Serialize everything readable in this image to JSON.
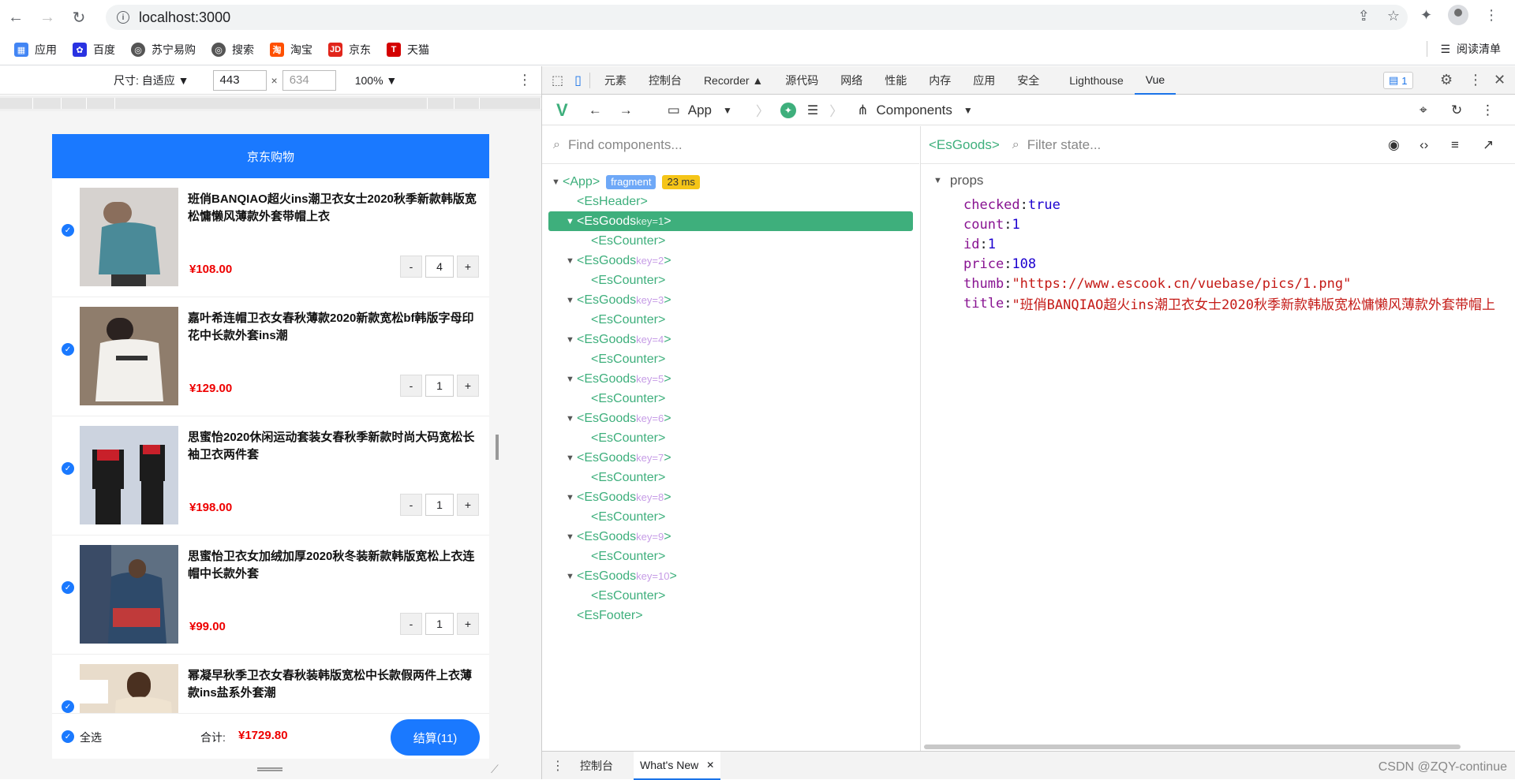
{
  "browser": {
    "url": "localhost:3000",
    "bookmarks": [
      {
        "label": "应用",
        "color": "#4285f4"
      },
      {
        "label": "百度",
        "color": "#2932e1"
      },
      {
        "label": "苏宁易购",
        "color": "#555555"
      },
      {
        "label": "搜索",
        "color": "#555555"
      },
      {
        "label": "淘宝",
        "color": "#ff5000"
      },
      {
        "label": "京东",
        "color": "#e1251b"
      },
      {
        "label": "天猫",
        "color": "#d40000"
      }
    ],
    "reading_list": "阅读清单"
  },
  "device": {
    "size_label": "尺寸: 自适应 ▼",
    "width": "443",
    "height_placeholder": "634",
    "times": "×",
    "zoom": "100% ▼"
  },
  "app": {
    "header": "京东购物",
    "goods": [
      {
        "title": "班俏BANQIAO超火ins潮卫衣女士2020秋季新款韩版宽松慵懒风薄款外套带帽上衣",
        "price": "¥108.00",
        "count": "4"
      },
      {
        "title": "嘉叶希连帽卫衣女春秋薄款2020新款宽松bf韩版字母印花中长款外套ins潮",
        "price": "¥129.00",
        "count": "1"
      },
      {
        "title": "思蜜怡2020休闲运动套装女春秋季新款时尚大码宽松长袖卫衣两件套",
        "price": "¥198.00",
        "count": "1"
      },
      {
        "title": "思蜜怡卫衣女加绒加厚2020秋冬装新款韩版宽松上衣连帽中长款外套",
        "price": "¥99.00",
        "count": "1"
      },
      {
        "title": "幂凝早秋季卫衣女春秋装韩版宽松中长款假两件上衣薄款ins盐系外套潮",
        "price": "",
        "count": ""
      }
    ],
    "minus": "-",
    "plus": "+",
    "footer": {
      "select_all": "全选",
      "total_label": "合计:",
      "total_value": "¥1729.80",
      "checkout": "结算(11)"
    }
  },
  "devtools": {
    "tabs": [
      "元素",
      "控制台",
      "Recorder ▲",
      "源代码",
      "网络",
      "性能",
      "内存",
      "应用",
      "安全",
      "Lighthouse",
      "Vue"
    ],
    "badge": "1",
    "vue_bar": {
      "app": "App",
      "components": "Components"
    },
    "find_placeholder": "Find components...",
    "filter_placeholder": "Filter state...",
    "selected_component": "<EsGoods>",
    "tree": {
      "app": "<App>",
      "fragment": "fragment",
      "time": "23 ms",
      "header": "<EsHeader>",
      "footer": "<EsFooter>",
      "goods_label": "<EsGoods",
      "counter": "<EsCounter>",
      "keys": [
        "key=1",
        "key=2",
        "key=3",
        "key=4",
        "key=5",
        "key=6",
        "key=7",
        "key=8",
        "key=9",
        "key=10"
      ]
    },
    "props_title": "props",
    "props": [
      {
        "key": "checked",
        "value": "true",
        "kind": "num"
      },
      {
        "key": "count",
        "value": "1",
        "kind": "num"
      },
      {
        "key": "id",
        "value": "1",
        "kind": "num"
      },
      {
        "key": "price",
        "value": "108",
        "kind": "num"
      },
      {
        "key": "thumb",
        "value": "\"https://www.escook.cn/vuebase/pics/1.png\"",
        "kind": "str"
      },
      {
        "key": "title",
        "value": "\"班俏BANQIAO超火ins潮卫衣女士2020秋季新款韩版宽松慵懒风薄款外套带帽上",
        "kind": "str"
      }
    ],
    "drawer": {
      "console": "控制台",
      "whats_new": "What's New"
    }
  },
  "watermark": "CSDN @ZQY-continue"
}
